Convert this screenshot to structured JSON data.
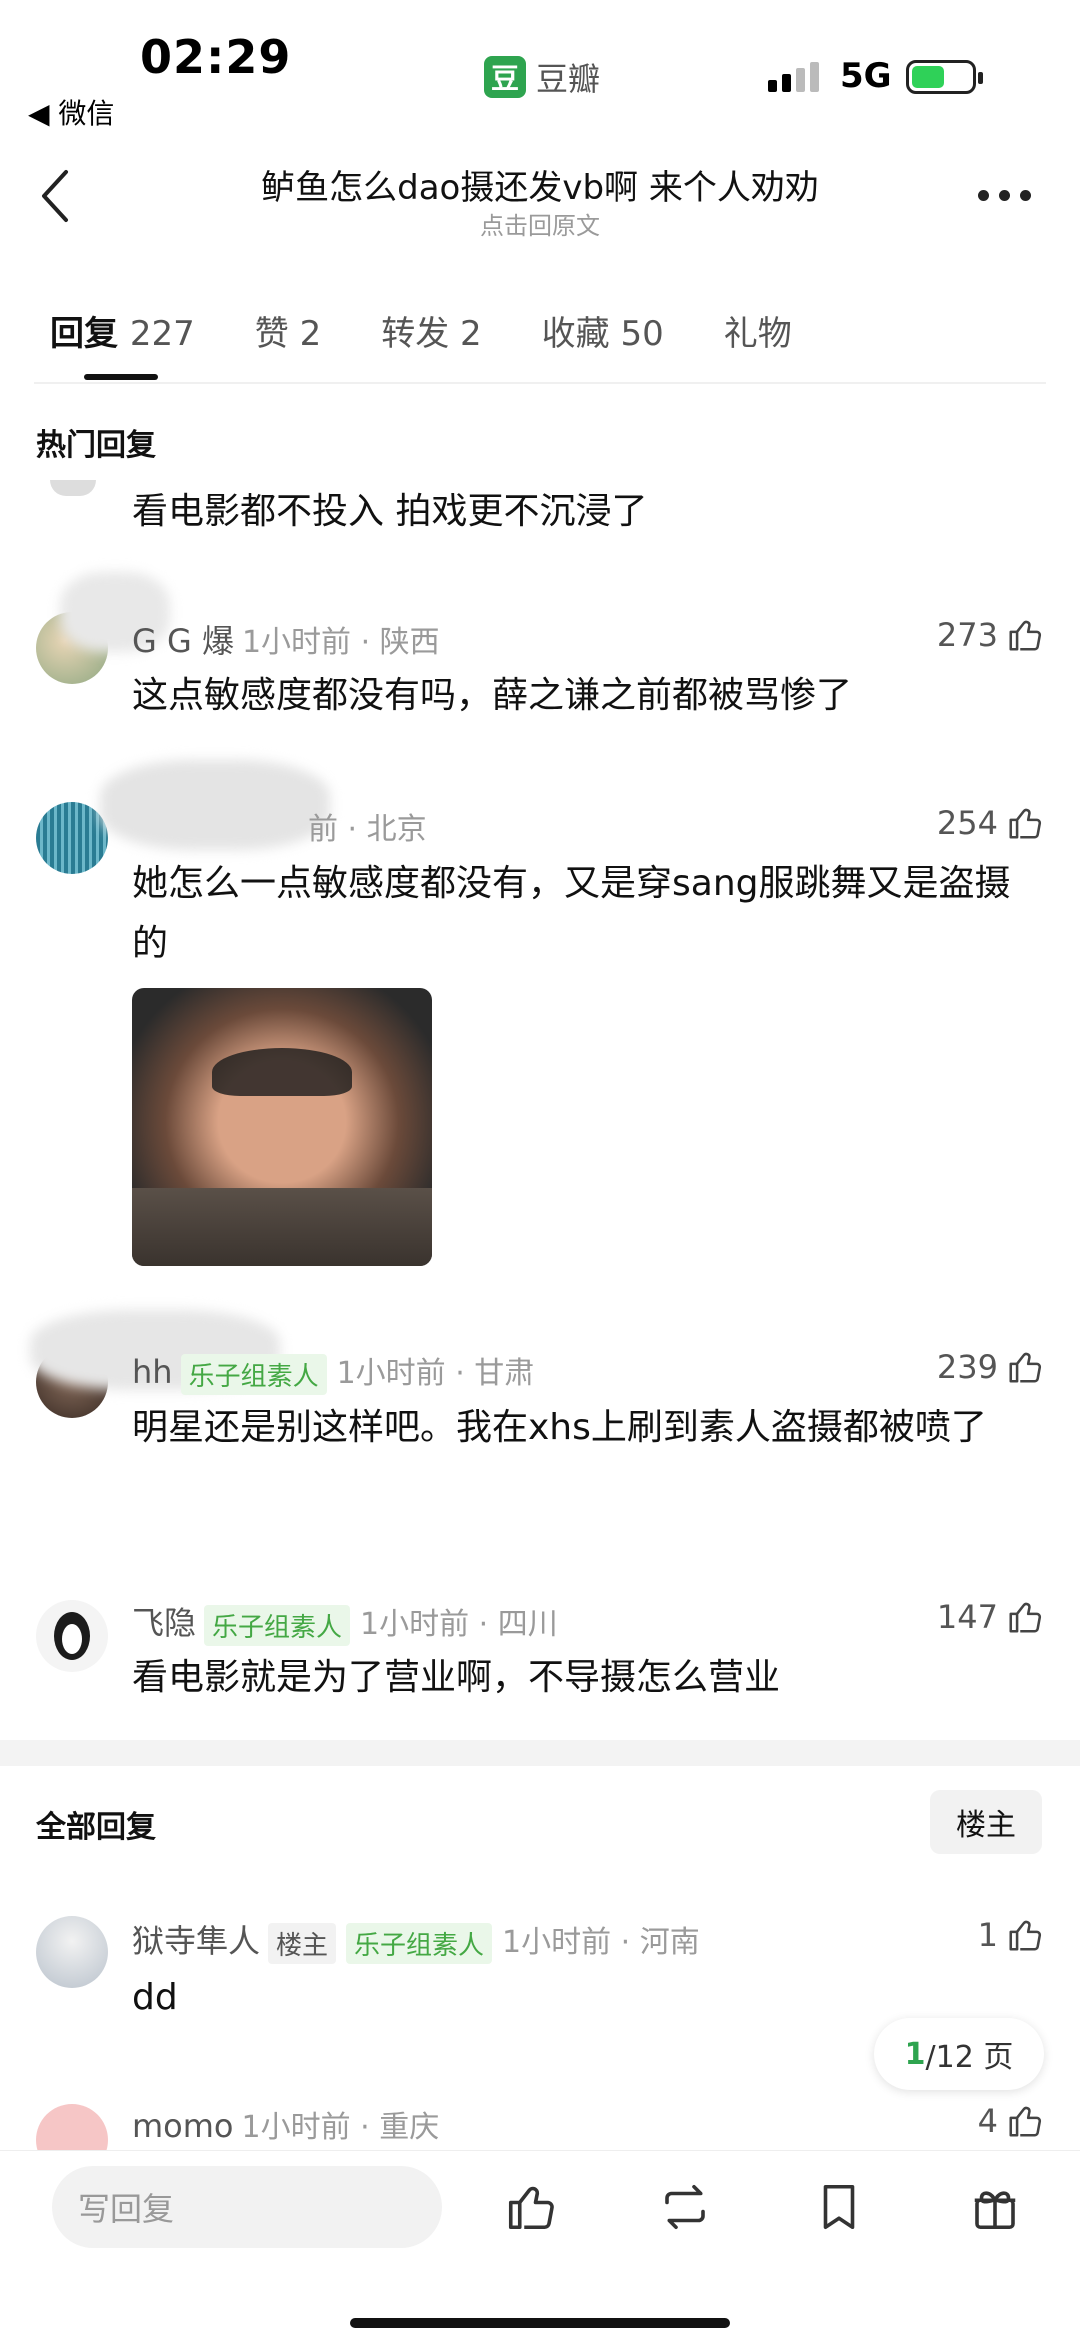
{
  "status_bar": {
    "time": "02:29",
    "back_app": "◀ 微信",
    "app_logo_char": "豆",
    "app_name": "豆瓣",
    "network": "5G"
  },
  "header": {
    "title": "鲈鱼怎么dao摄还发vb啊 来个人劝劝",
    "subtitle": "点击回原文"
  },
  "tabs": [
    {
      "label": "回复",
      "count": "227"
    },
    {
      "label": "赞",
      "count": "2"
    },
    {
      "label": "转发",
      "count": "2"
    },
    {
      "label": "收藏",
      "count": "50"
    },
    {
      "label": "礼物",
      "count": ""
    }
  ],
  "hot_section_title": "热门回复",
  "partial_top_comment": "看电影都不投入 拍戏更不沉浸了",
  "hot_replies": [
    {
      "name": "G G 爆",
      "badge": "",
      "time_loc": "1小时前 · 陕西",
      "likes": "273",
      "content": "这点敏感度都没有吗，薛之谦之前都被骂惨了"
    },
    {
      "name": "",
      "badge": "",
      "time_loc": "前 · 北京",
      "likes": "254",
      "content": "她怎么一点敏感度都没有，又是穿sang服跳舞又是盗摄的"
    },
    {
      "name": "hh",
      "badge": "乐子组素人",
      "time_loc": "1小时前 · 甘肃",
      "likes": "239",
      "content": "明星还是别这样吧。我在xhs上刷到素人盗摄都被喷了"
    },
    {
      "name": "飞隐",
      "badge": "乐子组素人",
      "time_loc": "1小时前 · 四川",
      "likes": "147",
      "content": "看电影就是为了营业啊，不导摄怎么营业"
    }
  ],
  "all_section_title": "全部回复",
  "owner_filter_label": "楼主",
  "all_replies": [
    {
      "name": "狱寺隼人",
      "owner_badge": "楼主",
      "badge": "乐子组素人",
      "time_loc": "1小时前 · 河南",
      "likes": "1",
      "content": "dd"
    },
    {
      "name": "momo",
      "owner_badge": "",
      "badge": "",
      "time_loc": "1小时前 · 重庆",
      "likes": "4",
      "content": ""
    }
  ],
  "pager": {
    "current": "1",
    "total_label": "/12 页"
  },
  "bottom_bar": {
    "reply_placeholder": "写回复"
  },
  "colors": {
    "accent_green": "#2ea44f",
    "badge_green": "#44a844",
    "muted": "#9a9a9a"
  }
}
